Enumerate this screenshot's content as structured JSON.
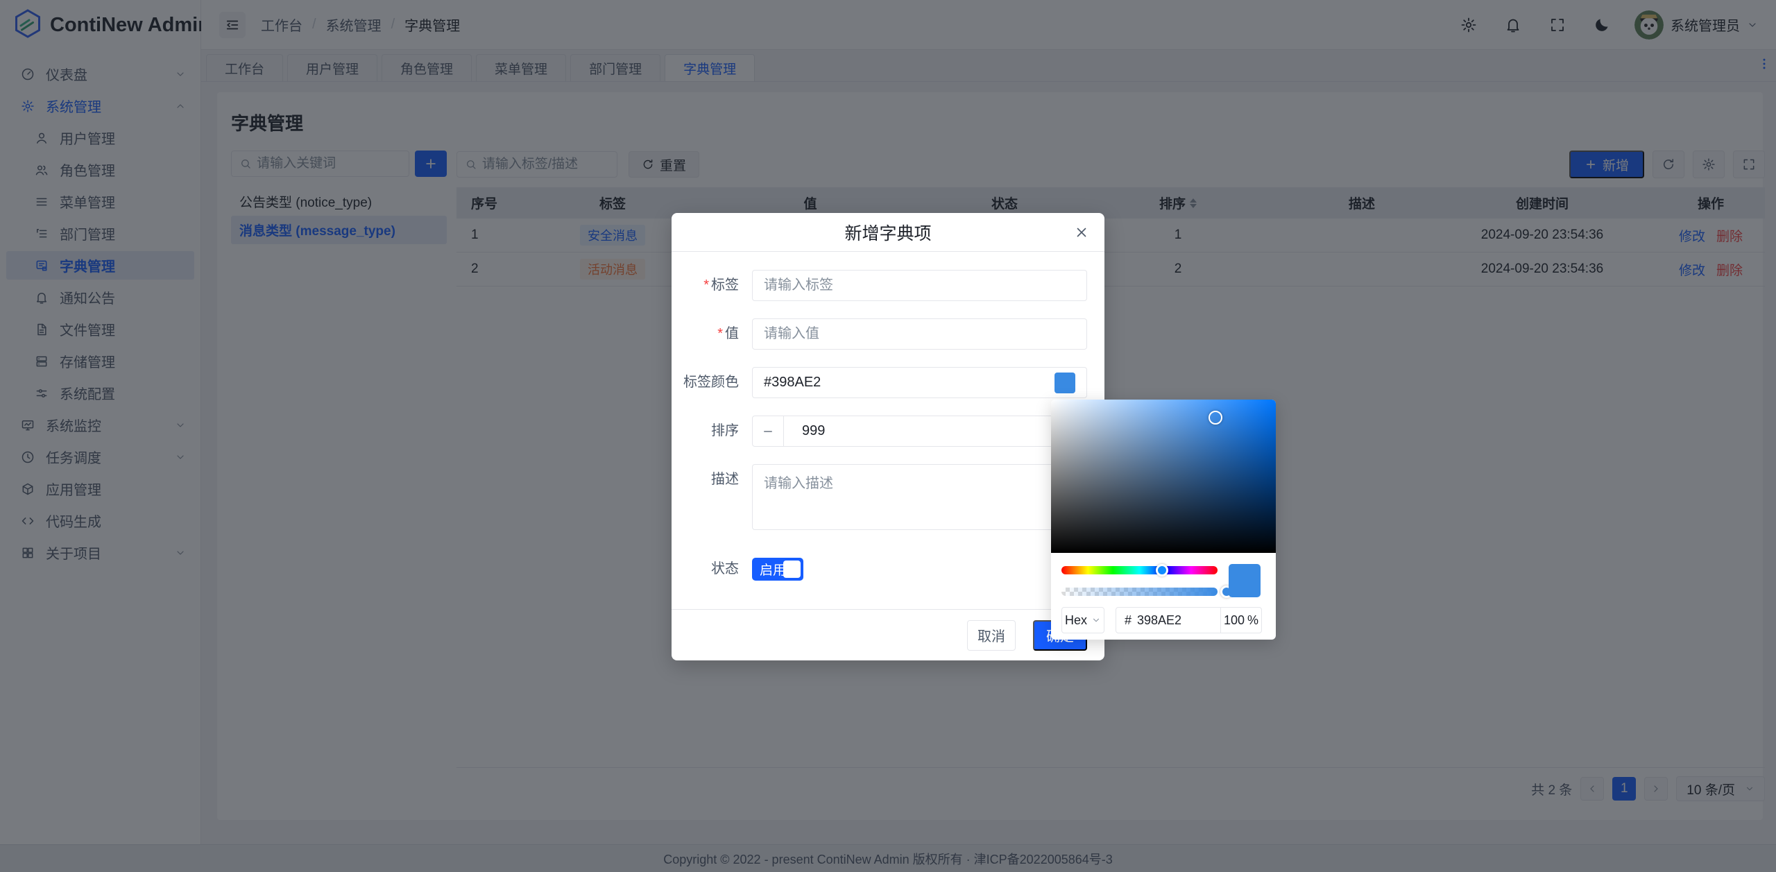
{
  "app": {
    "title": "ContiNew Admin",
    "footer": "Copyright © 2022 - present ContiNew Admin 版权所有 · 津ICP备2022005864号-3"
  },
  "header": {
    "breadcrumb": [
      "工作台",
      "系统管理",
      "字典管理"
    ],
    "breadcrumb_sep": "/",
    "user": "系统管理员"
  },
  "tabs": {
    "items": [
      {
        "label": "工作台"
      },
      {
        "label": "用户管理"
      },
      {
        "label": "角色管理"
      },
      {
        "label": "菜单管理"
      },
      {
        "label": "部门管理"
      },
      {
        "label": "字典管理"
      }
    ]
  },
  "sidebar": {
    "items": [
      {
        "label": "仪表盘"
      },
      {
        "label": "系统管理"
      },
      {
        "label": "用户管理"
      },
      {
        "label": "角色管理"
      },
      {
        "label": "菜单管理"
      },
      {
        "label": "部门管理"
      },
      {
        "label": "字典管理"
      },
      {
        "label": "通知公告"
      },
      {
        "label": "文件管理"
      },
      {
        "label": "存储管理"
      },
      {
        "label": "系统配置"
      },
      {
        "label": "系统监控"
      },
      {
        "label": "任务调度"
      },
      {
        "label": "应用管理"
      },
      {
        "label": "代码生成"
      },
      {
        "label": "关于项目"
      }
    ]
  },
  "page": {
    "title": "字典管理",
    "dict_panel": {
      "search_placeholder": "请输入关键词",
      "items": [
        {
          "label": "公告类型 (notice_type)"
        },
        {
          "label": "消息类型 (message_type)"
        }
      ]
    },
    "toolbar": {
      "search_placeholder": "请输入标签/描述",
      "reset": "重置",
      "add": "新增"
    },
    "table": {
      "columns": [
        "序号",
        "标签",
        "值",
        "状态",
        "排序",
        "描述",
        "创建时间",
        "操作"
      ],
      "rows": [
        {
          "index": "1",
          "tag": "安全消息",
          "value": "",
          "status": "",
          "sort": "1",
          "desc": "",
          "created": "2024-09-20 23:54:36",
          "edit": "修改",
          "delete": "删除"
        },
        {
          "index": "2",
          "tag": "活动消息",
          "value": "",
          "status": "",
          "sort": "2",
          "desc": "",
          "created": "2024-09-20 23:54:36",
          "edit": "修改",
          "delete": "删除"
        }
      ]
    },
    "pagination": {
      "total": "共 2 条",
      "page": "1",
      "size": "10 条/页"
    }
  },
  "modal": {
    "title": "新增字典项",
    "required_mark": "*",
    "fields": {
      "label": {
        "name": "标签",
        "placeholder": "请输入标签"
      },
      "value": {
        "name": "值",
        "placeholder": "请输入值"
      },
      "color": {
        "name": "标签颜色",
        "value": "#398AE2"
      },
      "sort": {
        "name": "排序",
        "value": "999"
      },
      "desc": {
        "name": "描述",
        "placeholder": "请输入描述"
      },
      "status": {
        "name": "状态",
        "on_label": "启用"
      }
    },
    "cancel": "取消",
    "confirm": "确定"
  },
  "color_picker": {
    "format": "Hex",
    "hex_prefix": "#",
    "hex": "398AE2",
    "alpha": "100",
    "alpha_unit": "%",
    "color": "#398AE2",
    "accent": "#165dff"
  }
}
